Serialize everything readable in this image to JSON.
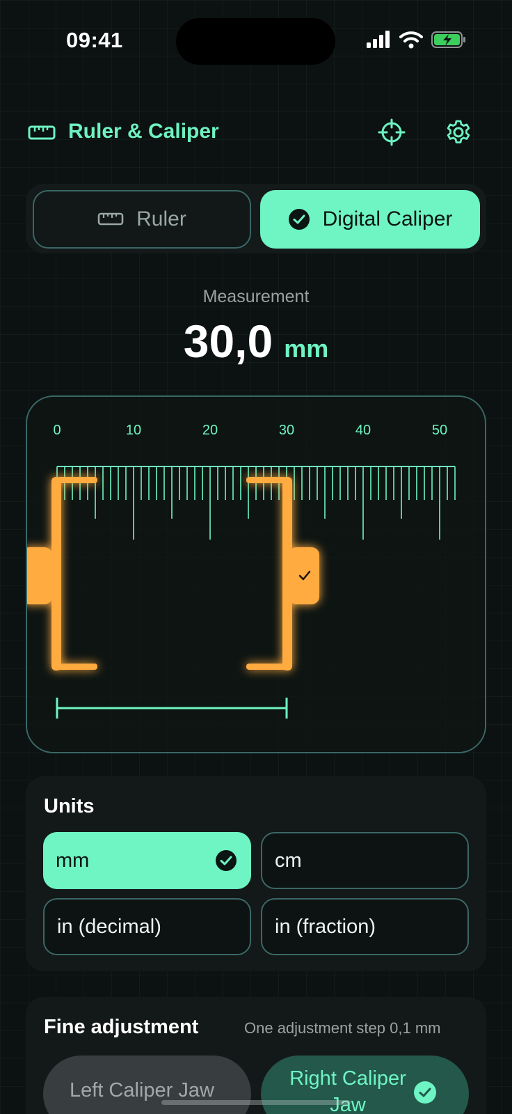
{
  "status_bar": {
    "time": "09:41"
  },
  "header": {
    "title": "Ruler & Caliper"
  },
  "mode": {
    "ruler_label": "Ruler",
    "caliper_label": "Digital Caliper",
    "active": "caliper"
  },
  "measurement": {
    "label": "Measurement",
    "value": "30,0",
    "unit": "mm"
  },
  "caliper": {
    "scale_labels": [
      "0",
      "10",
      "20",
      "30",
      "40",
      "50"
    ],
    "scale_max_mm": 52,
    "left_jaw_mm": 0,
    "right_jaw_mm": 30
  },
  "units": {
    "title": "Units",
    "options": [
      {
        "label": "mm",
        "selected": true
      },
      {
        "label": "cm",
        "selected": false
      },
      {
        "label": "in (decimal)",
        "selected": false
      },
      {
        "label": "in (fraction)",
        "selected": false
      }
    ]
  },
  "fine_adjustment": {
    "title": "Fine adjustment",
    "note": "One adjustment step 0,1 mm",
    "left_jaw_label": "Left Caliper Jaw",
    "right_jaw_label": "Right Caliper Jaw",
    "active": "right"
  },
  "colors": {
    "accent": "#6ef5c3",
    "jaw": "#ffab40",
    "border": "#3a6766",
    "background": "#0c1211"
  },
  "icons": [
    "ruler-icon",
    "crosshair-icon",
    "gear-icon",
    "check-circle-icon"
  ]
}
